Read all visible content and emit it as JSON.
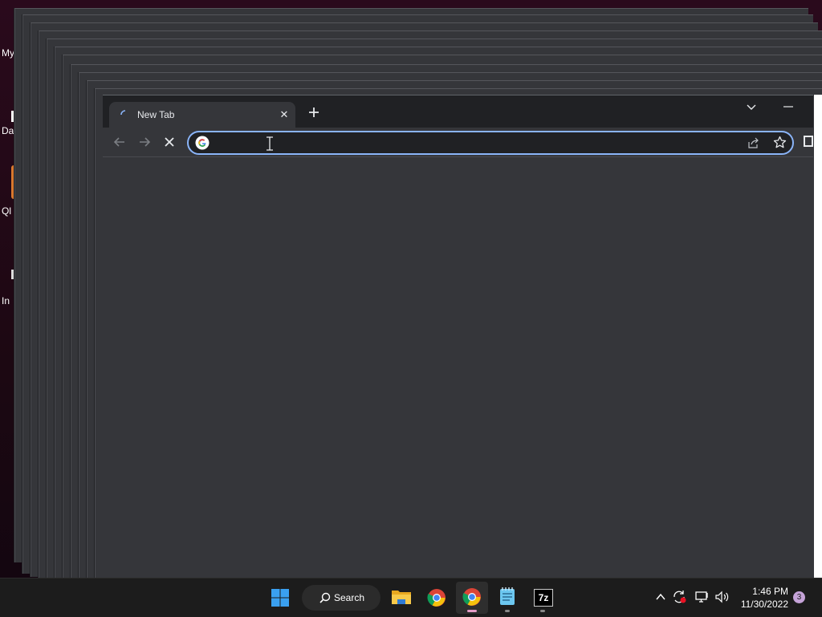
{
  "desktop": {
    "icons": [
      {
        "label": "My"
      },
      {
        "label": "Da"
      },
      {
        "label": "Ql"
      },
      {
        "label": "In"
      }
    ]
  },
  "browser": {
    "tab": {
      "title": "New Tab",
      "close_label": "✕"
    },
    "omnibox": {
      "value": "",
      "placeholder": ""
    }
  },
  "taskbar": {
    "search_label": "Search",
    "apps": [
      {
        "name": "Start",
        "icon": "windows-start-icon"
      },
      {
        "name": "File Explorer",
        "icon": "folder-icon"
      },
      {
        "name": "Google Chrome",
        "icon": "chrome-icon"
      },
      {
        "name": "Google Chrome (active)",
        "icon": "chrome-icon"
      },
      {
        "name": "Notepad",
        "icon": "notepad-icon"
      },
      {
        "name": "7-Zip",
        "icon": "7zip-icon",
        "glyph": "7z"
      }
    ],
    "clock": {
      "time": "1:46 PM",
      "date": "11/30/2022"
    },
    "notification_count": "3"
  },
  "colors": {
    "accent": "#8ab4f8",
    "chrome_dark": "#35363a",
    "tab_strip": "#202124",
    "taskbar": "#1c1c1c"
  }
}
